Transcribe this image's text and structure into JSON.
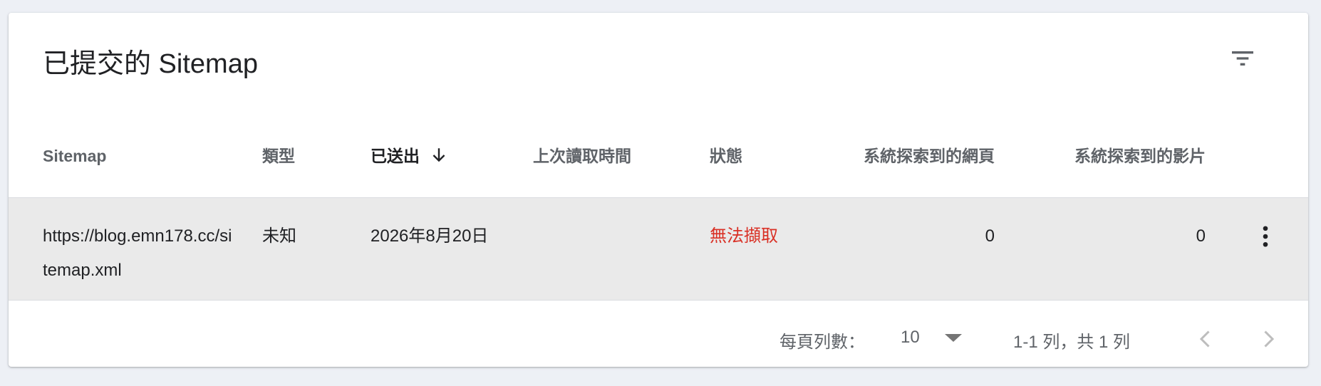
{
  "card": {
    "title": "已提交的 Sitemap",
    "filter_icon": "filter-list-icon"
  },
  "table": {
    "columns": [
      {
        "label": "Sitemap"
      },
      {
        "label": "類型"
      },
      {
        "label": "已送出",
        "sorted": "desc",
        "sort_icon": "arrow-downward-icon"
      },
      {
        "label": "上次讀取時間"
      },
      {
        "label": "狀態"
      },
      {
        "label": "系統探索到的網頁"
      },
      {
        "label": "系統探索到的影片"
      }
    ],
    "rows": [
      {
        "sitemap": "https://blog.emn178.cc/sitemap.xml",
        "type": "未知",
        "submitted": "2026年8月20日",
        "last_read": "",
        "status": "無法擷取",
        "pages": "0",
        "videos": "0",
        "more_icon": "more-vert-icon"
      }
    ]
  },
  "pagination": {
    "rows_per_page_label": "每頁列數：",
    "rows_per_page_value": "10",
    "range_label": "1-1 列，共 1 列",
    "prev_icon": "chevron-left-icon",
    "next_icon": "chevron-right-icon"
  },
  "colors": {
    "background": "#edf0f5",
    "card": "#ffffff",
    "row_highlight": "#eaeaea",
    "status_error": "#d93025",
    "header_text": "#5f6368",
    "divider": "#dadce0"
  }
}
